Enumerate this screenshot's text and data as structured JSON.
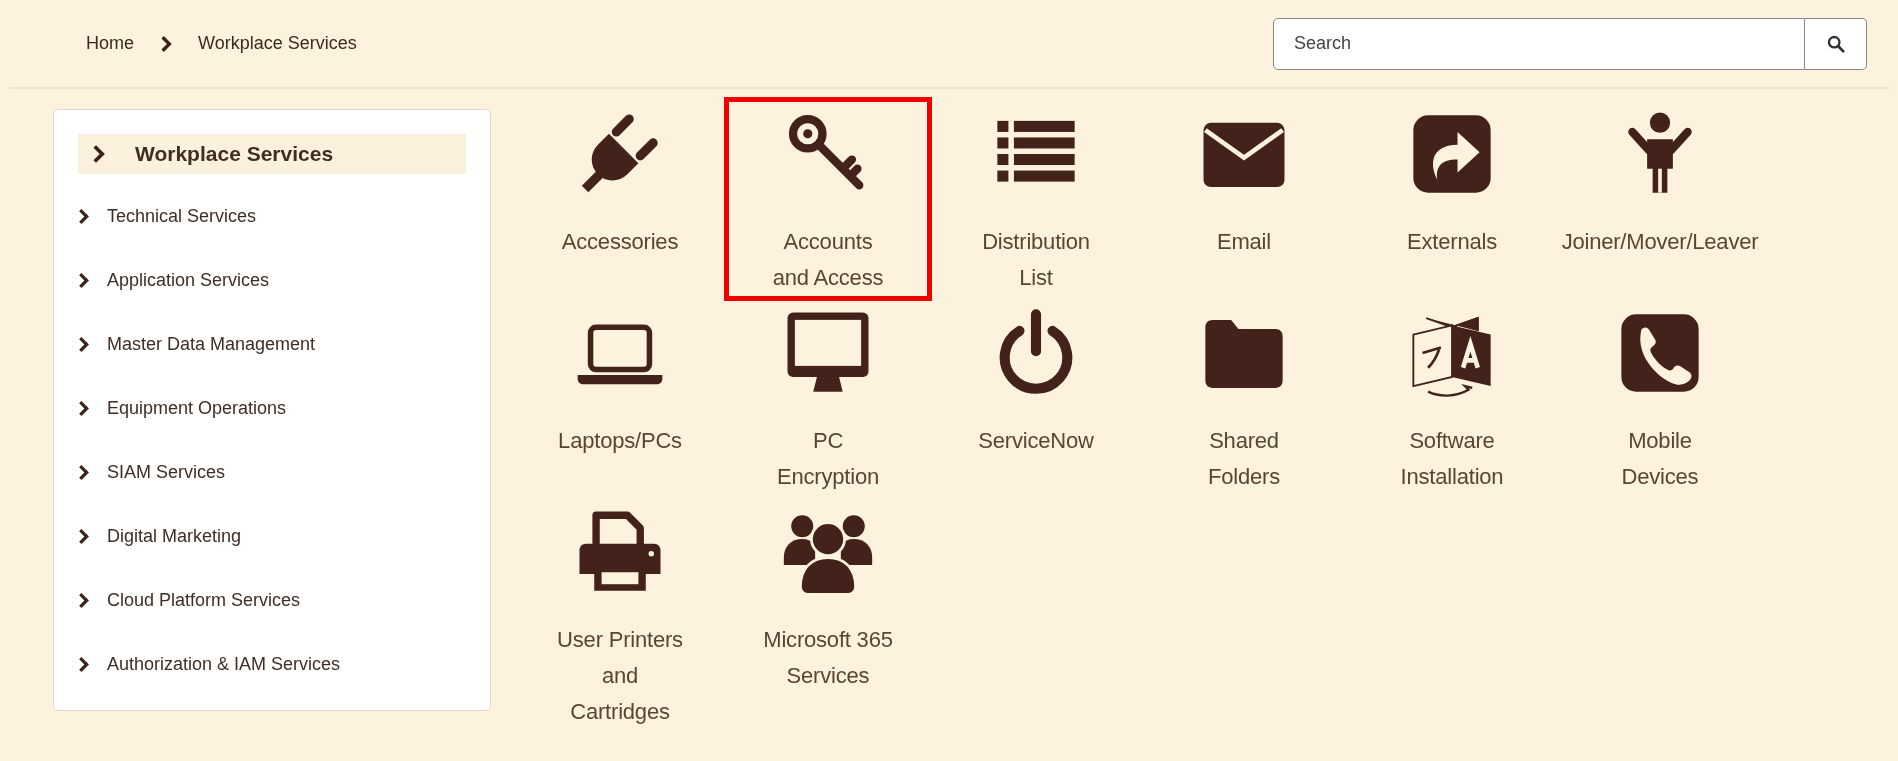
{
  "breadcrumb": [
    "Home",
    "Workplace Services"
  ],
  "search": {
    "placeholder": "Search"
  },
  "sidebar": {
    "items": [
      {
        "label": "Workplace Services",
        "selected": true
      },
      {
        "label": "Technical Services",
        "selected": false
      },
      {
        "label": "Application Services",
        "selected": false
      },
      {
        "label": "Master Data Management",
        "selected": false
      },
      {
        "label": "Equipment Operations",
        "selected": false
      },
      {
        "label": "SIAM Services",
        "selected": false
      },
      {
        "label": "Digital Marketing",
        "selected": false
      },
      {
        "label": "Cloud Platform Services",
        "selected": false
      },
      {
        "label": "Authorization & IAM Services",
        "selected": false
      }
    ]
  },
  "tiles": [
    {
      "label": "Accessories",
      "kind": "plug",
      "selected": false
    },
    {
      "label": "Accounts and Access",
      "kind": "key",
      "selected": true
    },
    {
      "label": "Distribution List",
      "kind": "list",
      "selected": false
    },
    {
      "label": "Email",
      "kind": "envelope",
      "selected": false
    },
    {
      "label": "Externals",
      "kind": "share",
      "selected": false
    },
    {
      "label": "Joiner/Mover/Leaver",
      "kind": "person",
      "selected": false
    },
    {
      "label": "Laptops/PCs",
      "kind": "laptop",
      "selected": false
    },
    {
      "label": "PC Encryption",
      "kind": "monitor",
      "selected": false
    },
    {
      "label": "ServiceNow",
      "kind": "power",
      "selected": false
    },
    {
      "label": "Shared Folders",
      "kind": "folder",
      "selected": false
    },
    {
      "label": "Software Installation",
      "kind": "translate",
      "selected": false
    },
    {
      "label": "Mobile Devices",
      "kind": "phone",
      "selected": false
    },
    {
      "label": "User Printers and Cartridges",
      "kind": "printer",
      "selected": false
    },
    {
      "label": "Microsoft 365 Services",
      "kind": "users",
      "selected": false
    }
  ]
}
